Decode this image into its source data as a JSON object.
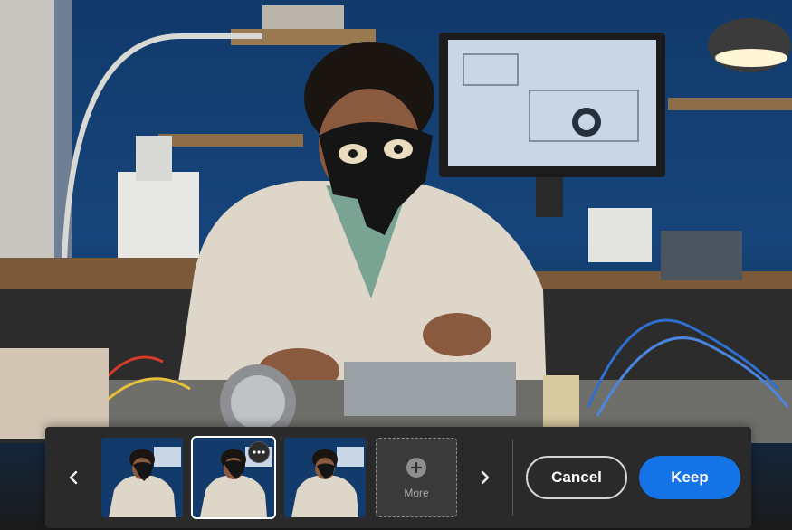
{
  "canvas": {
    "subject": "photo",
    "colors": {
      "wall": "#16447a",
      "coat": "#ded6c8",
      "mask": "#151515",
      "monitor_screen": "#c9d6e6"
    }
  },
  "toolbar": {
    "prev_icon": "chevron-left-icon",
    "next_icon": "chevron-right-icon",
    "variations": [
      {
        "id": "variation-1",
        "selected": false
      },
      {
        "id": "variation-2",
        "selected": true,
        "menu_icon": "more-horizontal-icon"
      },
      {
        "id": "variation-3",
        "selected": false
      }
    ],
    "more_label": "More",
    "more_icon": "plus-icon",
    "cancel_label": "Cancel",
    "keep_label": "Keep",
    "accent_color": "#1473e6"
  }
}
